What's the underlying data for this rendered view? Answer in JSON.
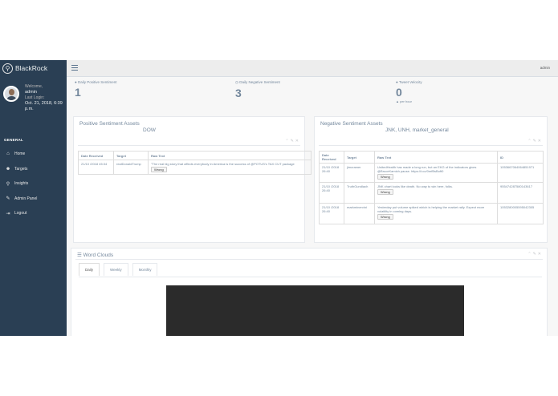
{
  "brand": {
    "name": "BlackRock",
    "logo_icon": "search-icon"
  },
  "profile": {
    "welcome": "Welcome,",
    "username": "admin",
    "last_login_label": "Last Login:",
    "last_login_date": "Oct. 21, 2018, 6:39 p.m."
  },
  "sidebar": {
    "section": "GENERAL",
    "items": [
      {
        "label": "Home",
        "icon": "home-icon",
        "glyph": "⌂"
      },
      {
        "label": "Targets",
        "icon": "users-icon",
        "glyph": "☻"
      },
      {
        "label": "Insights",
        "icon": "search-icon",
        "glyph": "⚲"
      },
      {
        "label": "Admin Panel",
        "icon": "wrench-icon",
        "glyph": "✎"
      },
      {
        "label": "Logout",
        "icon": "sign-out-icon",
        "glyph": "⇥"
      }
    ]
  },
  "topbar": {
    "user": "admin"
  },
  "tiles": [
    {
      "label": "Daily Positive Sentiment",
      "icon": "user-icon",
      "glyph": "●",
      "value": "1"
    },
    {
      "label": "Daily Negative Sentiment",
      "icon": "clock-icon",
      "glyph": "◷",
      "value": "3"
    },
    {
      "label": "Tweet Velocity",
      "icon": "user-icon",
      "glyph": "●",
      "value": "0",
      "sub": "per hour",
      "sub_icon": "caret-up-icon"
    }
  ],
  "positive": {
    "title": "Positive Sentiment Assets",
    "subtitle": "DOW",
    "headers": [
      "Date Received",
      "Target",
      "Raw Text"
    ],
    "rows": [
      {
        "date": "21/10 /2018 45:34",
        "target": "realDonaldTrump",
        "text": "\"The real big story that affects everybody in America is the success of @POTUS's TAX CUT package",
        "button": "Wrong"
      }
    ]
  },
  "negative": {
    "title": "Negative Sentiment Assets",
    "subtitle": "JNK, UNH, market_general",
    "headers": [
      "Date Received",
      "Target",
      "Raw Text",
      "ID"
    ],
    "rows": [
      {
        "date": "21/10 /2018 26:40",
        "target": "jimcramer",
        "text": "UnitedHealth has made a long run, but an EKG of the indicators gives @BruceKamich pause. https://t.co/0mfBsBoft0",
        "button": "Wrong",
        "id": "1053667064064851971"
      },
      {
        "date": "21/10 /2018 26:40",
        "target": "TruthGundlach",
        "text": "JNK chart looks like death. No way to win here, folks.",
        "button": "Wrong",
        "id": "955474287580143617"
      },
      {
        "date": "21/10 /2018 26:40",
        "target": "markminervini",
        "text": "Yesterday put volume spiked which is helping the market rally. Expect more volatility in coming days.",
        "button": "Wrong",
        "id": "1053280005595042305"
      }
    ]
  },
  "wordclouds": {
    "title": "Word Clouds",
    "tabs": [
      "Daily",
      "Weekly",
      "Monthly"
    ]
  },
  "colors": {
    "sidebar": "#2a3f54",
    "background": "#f7f7f7",
    "text": "#73879c"
  }
}
